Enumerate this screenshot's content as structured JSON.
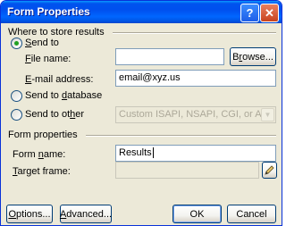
{
  "window": {
    "title": "Form Properties",
    "help_glyph": "?",
    "close_glyph": "✕"
  },
  "store_group": {
    "label": "Where to store results",
    "send_to": {
      "label_pre": "",
      "label_u": "S",
      "label_post": "end to",
      "checked": true
    },
    "file_name": {
      "label_pre": "",
      "label_u": "F",
      "label_post": "ile name:",
      "value": ""
    },
    "browse": {
      "label_pre": "B",
      "label_u": "r",
      "label_post": "owse..."
    },
    "email": {
      "label_pre": "",
      "label_u": "E",
      "label_post": "-mail address:",
      "value": "email@xyz.us"
    },
    "send_db": {
      "label_pre": "Send to ",
      "label_u": "d",
      "label_post": "atabase",
      "checked": false
    },
    "send_other": {
      "label_pre": "Send to ot",
      "label_u": "h",
      "label_post": "er",
      "checked": false
    },
    "other_combo": {
      "value": "Custom ISAPI, NSAPI, CGI, or ASP Script"
    }
  },
  "form_group": {
    "label": "Form properties",
    "form_name": {
      "label_pre": "Form ",
      "label_u": "n",
      "label_post": "ame:",
      "value": "Results"
    },
    "target_frame": {
      "label_pre": "",
      "label_u": "T",
      "label_post": "arget frame:",
      "value": ""
    }
  },
  "buttons": {
    "options": {
      "label_pre": "",
      "label_u": "O",
      "label_post": "ptions..."
    },
    "advanced": {
      "label_pre": "",
      "label_u": "A",
      "label_post": "dvanced..."
    },
    "ok": "OK",
    "cancel": "Cancel"
  },
  "icons": {
    "help": "help-icon",
    "close": "close-icon",
    "pencil": "pencil-icon",
    "dropdown": "chevron-down-icon"
  }
}
